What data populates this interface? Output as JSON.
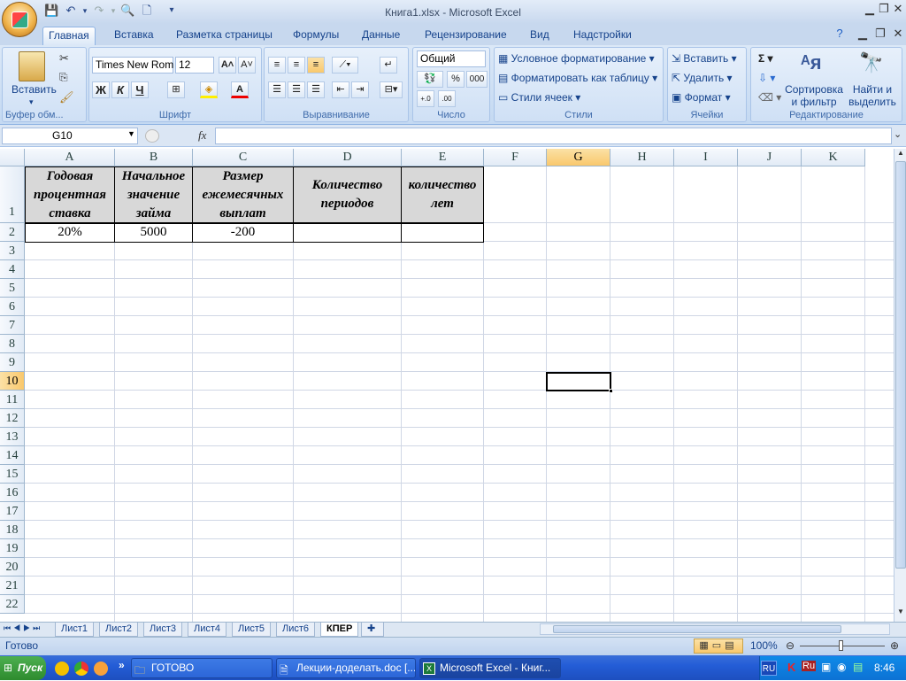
{
  "window": {
    "title": "Книга1.xlsx - Microsoft Excel"
  },
  "tabs": [
    "Главная",
    "Вставка",
    "Разметка страницы",
    "Формулы",
    "Данные",
    "Рецензирование",
    "Вид",
    "Надстройки"
  ],
  "ribbon": {
    "clipboard": {
      "paste": "Вставить",
      "label": "Буфер обм..."
    },
    "font": {
      "name": "Times New Rom",
      "size": "12",
      "bold": "Ж",
      "italic": "К",
      "underline": "Ч",
      "label": "Шрифт"
    },
    "alignment": {
      "label": "Выравнивание"
    },
    "number": {
      "format": "Общий",
      "percent": "%",
      "thousands": "000",
      "label": "Число"
    },
    "styles": {
      "conditional": "Условное форматирование",
      "as_table": "Форматировать как таблицу",
      "cell_styles": "Стили ячеек",
      "label": "Стили"
    },
    "cells": {
      "insert": "Вставить",
      "delete": "Удалить",
      "format": "Формат",
      "label": "Ячейки"
    },
    "editing": {
      "sort_l1": "Сортировка",
      "sort_l2": "и фильтр",
      "find_l1": "Найти и",
      "find_l2": "выделить",
      "sigma": "Σ",
      "label": "Редактирование"
    }
  },
  "formula_bar": {
    "name_box": "G10",
    "fx": "fx",
    "content": ""
  },
  "columns": [
    "A",
    "B",
    "C",
    "D",
    "E",
    "F",
    "G",
    "H",
    "I",
    "J",
    "K"
  ],
  "rows": [
    "1",
    "2",
    "3",
    "4",
    "5",
    "6",
    "7",
    "8",
    "9",
    "10",
    "11",
    "12",
    "13",
    "14",
    "15",
    "16",
    "17",
    "18",
    "19",
    "20",
    "21",
    "22"
  ],
  "table": {
    "headers": [
      "Годовая процентная ставка",
      "Начальное значение займа",
      "Размер ежемесячных выплат",
      "Количество периодов",
      "количество лет"
    ],
    "values": [
      "20%",
      "5000",
      "-200",
      "",
      ""
    ]
  },
  "sheet_tabs": [
    "Лист1",
    "Лист2",
    "Лист3",
    "Лист4",
    "Лист5",
    "Лист6",
    "КПЕР"
  ],
  "status": {
    "ready": "Готово",
    "zoom": "100%"
  },
  "taskbar": {
    "start": "Пуск",
    "items": [
      "ГОТОВО",
      "Лекции-доделать.doc [...",
      "Microsoft Excel - Книг..."
    ],
    "lang": "RU",
    "lang2": "Ru",
    "clock": "8:46"
  }
}
